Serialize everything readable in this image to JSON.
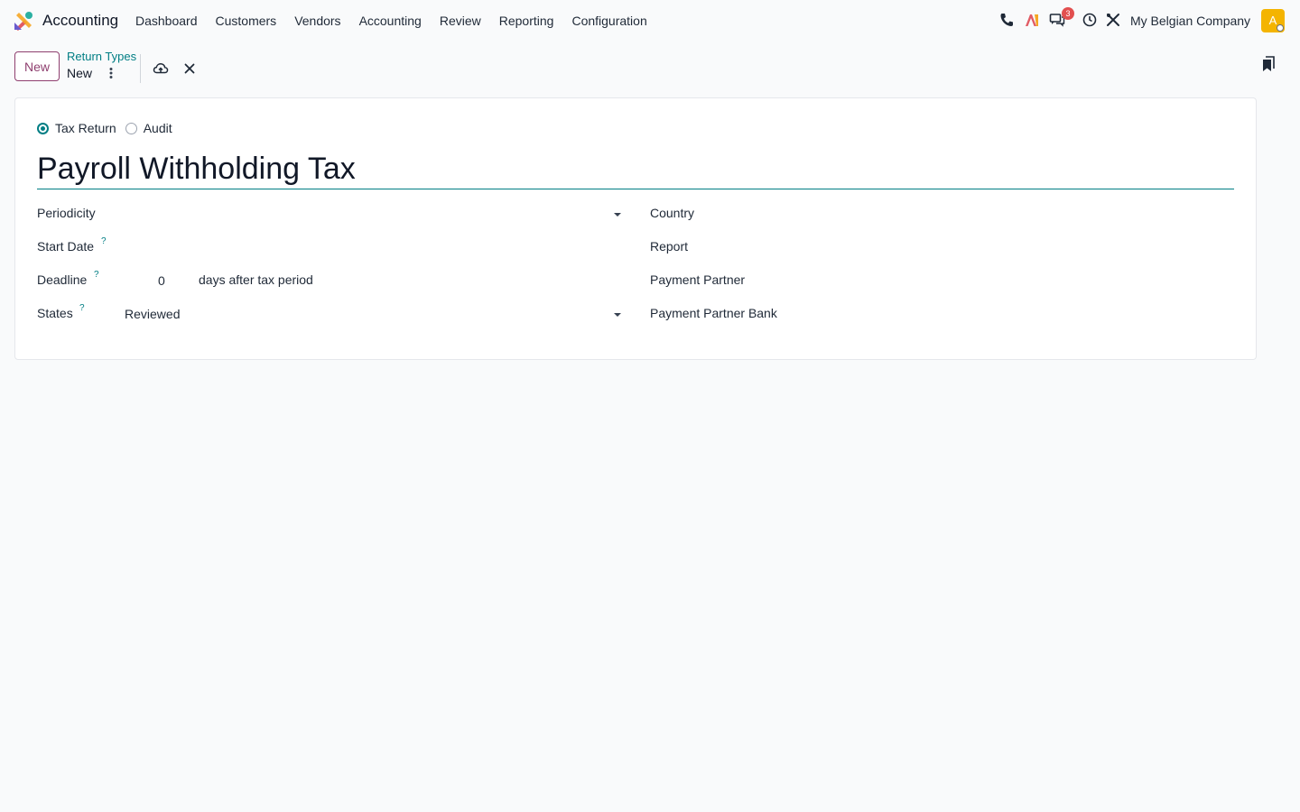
{
  "navbar": {
    "app_name": "Accounting",
    "menu": [
      "Dashboard",
      "Customers",
      "Vendors",
      "Accounting",
      "Review",
      "Reporting",
      "Configuration"
    ],
    "message_badge": "3",
    "company": "My Belgian Company",
    "avatar_initial": "A",
    "icons": [
      "phone-icon",
      "ai-icon",
      "messages-icon",
      "clock-icon",
      "tools-icon"
    ]
  },
  "control_panel": {
    "new_button": "New",
    "breadcrumb_parent": "Return Types",
    "breadcrumb_current": "New"
  },
  "form": {
    "type_options": [
      {
        "label": "Tax Return",
        "checked": true
      },
      {
        "label": "Audit",
        "checked": false
      }
    ],
    "name": "Payroll Withholding Tax",
    "left": {
      "periodicity_label": "Periodicity",
      "periodicity_value": "",
      "start_date_label": "Start Date",
      "start_date_help": "?",
      "deadline_label": "Deadline",
      "deadline_help": "?",
      "deadline_value": "0",
      "deadline_suffix": "days after tax period",
      "states_label": "States",
      "states_help": "?",
      "states_value": "Reviewed"
    },
    "right": {
      "country_label": "Country",
      "report_label": "Report",
      "payment_partner_label": "Payment Partner",
      "payment_partner_bank_label": "Payment Partner Bank"
    }
  },
  "colors": {
    "accent": "#017e84",
    "primary_button": "#8f3f6f",
    "badge": "#e24f4f",
    "avatar": "#f4b400"
  }
}
